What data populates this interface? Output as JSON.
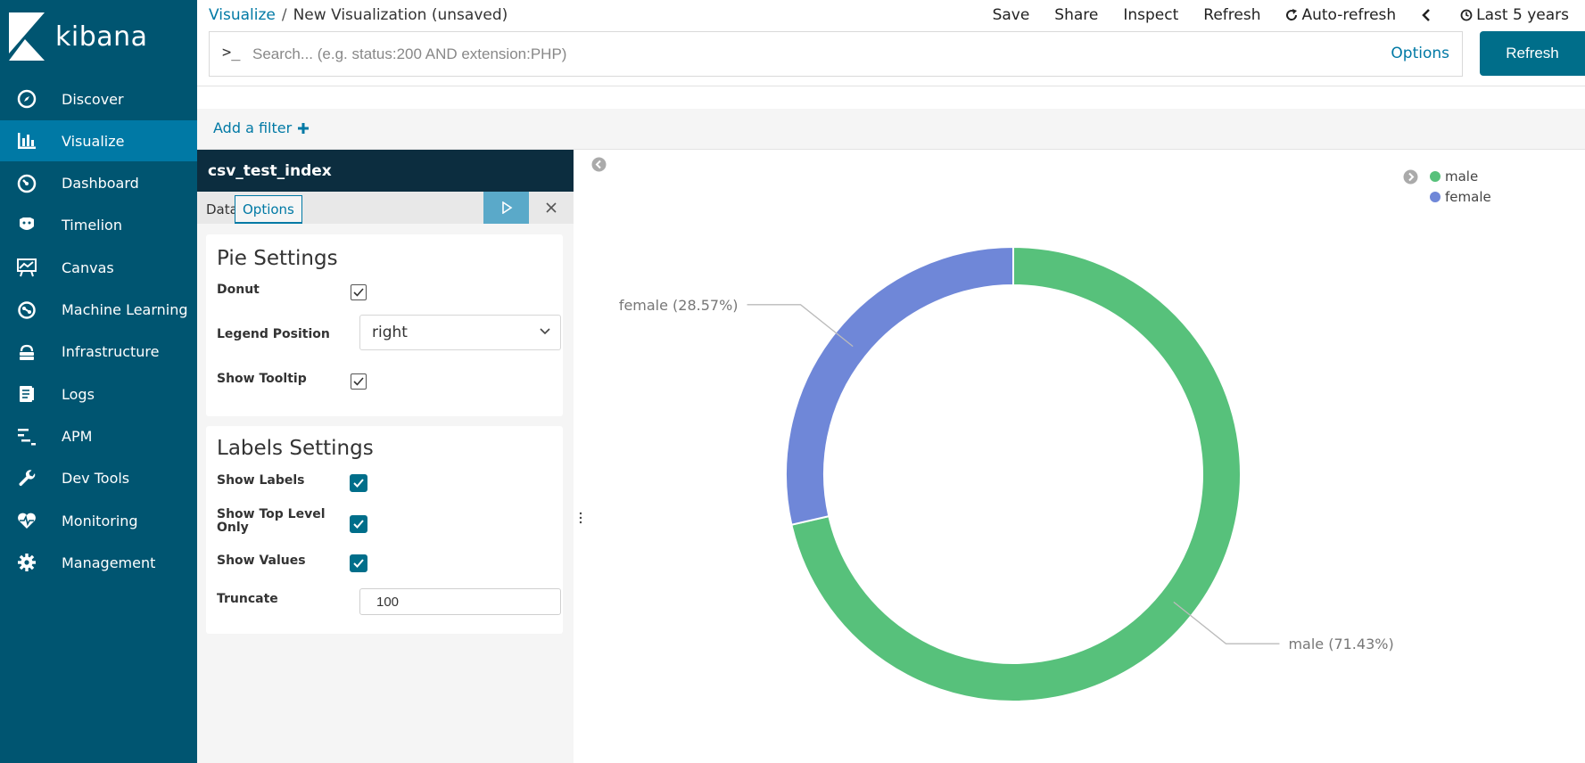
{
  "app": {
    "name": "kibana"
  },
  "sidebar": {
    "items": [
      {
        "label": "Discover",
        "icon": "compass-icon",
        "active": false
      },
      {
        "label": "Visualize",
        "icon": "bar-chart-icon",
        "active": true
      },
      {
        "label": "Dashboard",
        "icon": "gauge-icon",
        "active": false
      },
      {
        "label": "Timelion",
        "icon": "timelion-icon",
        "active": false
      },
      {
        "label": "Canvas",
        "icon": "canvas-icon",
        "active": false
      },
      {
        "label": "Machine Learning",
        "icon": "ml-icon",
        "active": false
      },
      {
        "label": "Infrastructure",
        "icon": "infrastructure-icon",
        "active": false
      },
      {
        "label": "Logs",
        "icon": "logs-icon",
        "active": false
      },
      {
        "label": "APM",
        "icon": "apm-icon",
        "active": false
      },
      {
        "label": "Dev Tools",
        "icon": "wrench-icon",
        "active": false
      },
      {
        "label": "Monitoring",
        "icon": "heartbeat-icon",
        "active": false
      },
      {
        "label": "Management",
        "icon": "gear-icon",
        "active": false
      }
    ]
  },
  "breadcrumb": {
    "root": "Visualize",
    "separator": "/",
    "current": "New Visualization (unsaved)"
  },
  "topmenu": {
    "save": "Save",
    "share": "Share",
    "inspect": "Inspect",
    "refresh": "Refresh",
    "auto_refresh": "Auto-refresh",
    "time_range": "Last 5 years"
  },
  "query": {
    "prompt": ">_",
    "placeholder": "Search... (e.g. status:200 AND extension:PHP)",
    "value": "",
    "options_label": "Options",
    "refresh_button": "Refresh"
  },
  "filter": {
    "add_label": "Add a filter"
  },
  "editor": {
    "index_name": "csv_test_index",
    "tabs": [
      {
        "label": "Data",
        "active": false
      },
      {
        "label": "Options",
        "active": true
      }
    ],
    "pie_settings": {
      "title": "Pie Settings",
      "donut_label": "Donut",
      "donut": true,
      "legend_position_label": "Legend Position",
      "legend_position": "right",
      "show_tooltip_label": "Show Tooltip",
      "show_tooltip": true
    },
    "labels_settings": {
      "title": "Labels Settings",
      "show_labels_label": "Show Labels",
      "show_labels": true,
      "show_top_level_label": "Show Top Level Only",
      "show_top_level": true,
      "show_values_label": "Show Values",
      "show_values": true,
      "truncate_label": "Truncate",
      "truncate": "100"
    }
  },
  "colors": {
    "sidebar": "#005571",
    "active": "#0079a5",
    "male": "#57c17b",
    "female": "#6f87d8"
  },
  "chart_data": {
    "type": "pie",
    "donut": true,
    "categories": [
      "male",
      "female"
    ],
    "values": [
      71.43,
      28.57
    ],
    "slice_labels": [
      "male (71.43%)",
      "female (28.57%)"
    ],
    "colors": [
      "#57c17b",
      "#6f87d8"
    ],
    "legend": [
      "male",
      "female"
    ],
    "legend_position": "top-right"
  }
}
